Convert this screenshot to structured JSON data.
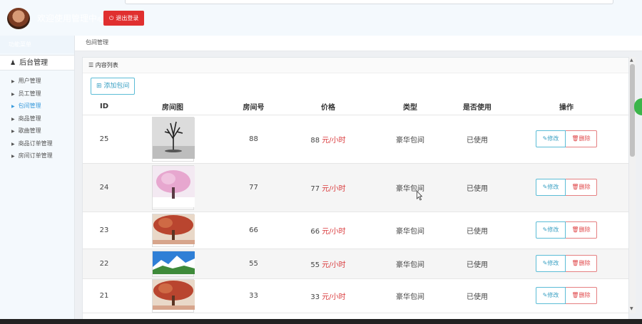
{
  "header": {
    "welcome_text": "欢迎使用管理中心",
    "logout_label": "退出登录",
    "accent": "#e02f2f"
  },
  "sidebar": {
    "head": "功能菜单",
    "menu_title": "后台管理",
    "items": [
      {
        "label": "用户管理",
        "active": false
      },
      {
        "label": "员工管理",
        "active": false
      },
      {
        "label": "包间管理",
        "active": true
      },
      {
        "label": "商品管理",
        "active": false
      },
      {
        "label": "歌曲管理",
        "active": false
      },
      {
        "label": "商品订单管理",
        "active": false
      },
      {
        "label": "房间订单管理",
        "active": false
      }
    ]
  },
  "breadcrumb": "包间管理",
  "panel": {
    "title": "内容列表",
    "add_label": "添加包间"
  },
  "table": {
    "headers": [
      "ID",
      "房间图",
      "房间号",
      "价格",
      "类型",
      "是否使用",
      "操作"
    ],
    "price_unit": "元/小时",
    "edit_label": "修改",
    "delete_label": "删除",
    "rows": [
      {
        "id": "25",
        "image": "bare-tree",
        "room": "88",
        "price": "88",
        "type": "豪华包间",
        "used": "已使用"
      },
      {
        "id": "24",
        "image": "pink-blossom-tree",
        "room": "77",
        "price": "77",
        "type": "豪华包间",
        "used": "已使用"
      },
      {
        "id": "23",
        "image": "red-autumn-tree",
        "room": "66",
        "price": "66",
        "type": "豪华包间",
        "used": "已使用"
      },
      {
        "id": "22",
        "image": "mountain-landscape",
        "room": "55",
        "price": "55",
        "type": "豪华包间",
        "used": "已使用"
      },
      {
        "id": "21",
        "image": "red-autumn-tree",
        "room": "33",
        "price": "33",
        "type": "豪华包间",
        "used": "已使用"
      }
    ]
  },
  "colors": {
    "accent_blue": "#3a9bdc",
    "price_red": "#d9383a"
  }
}
